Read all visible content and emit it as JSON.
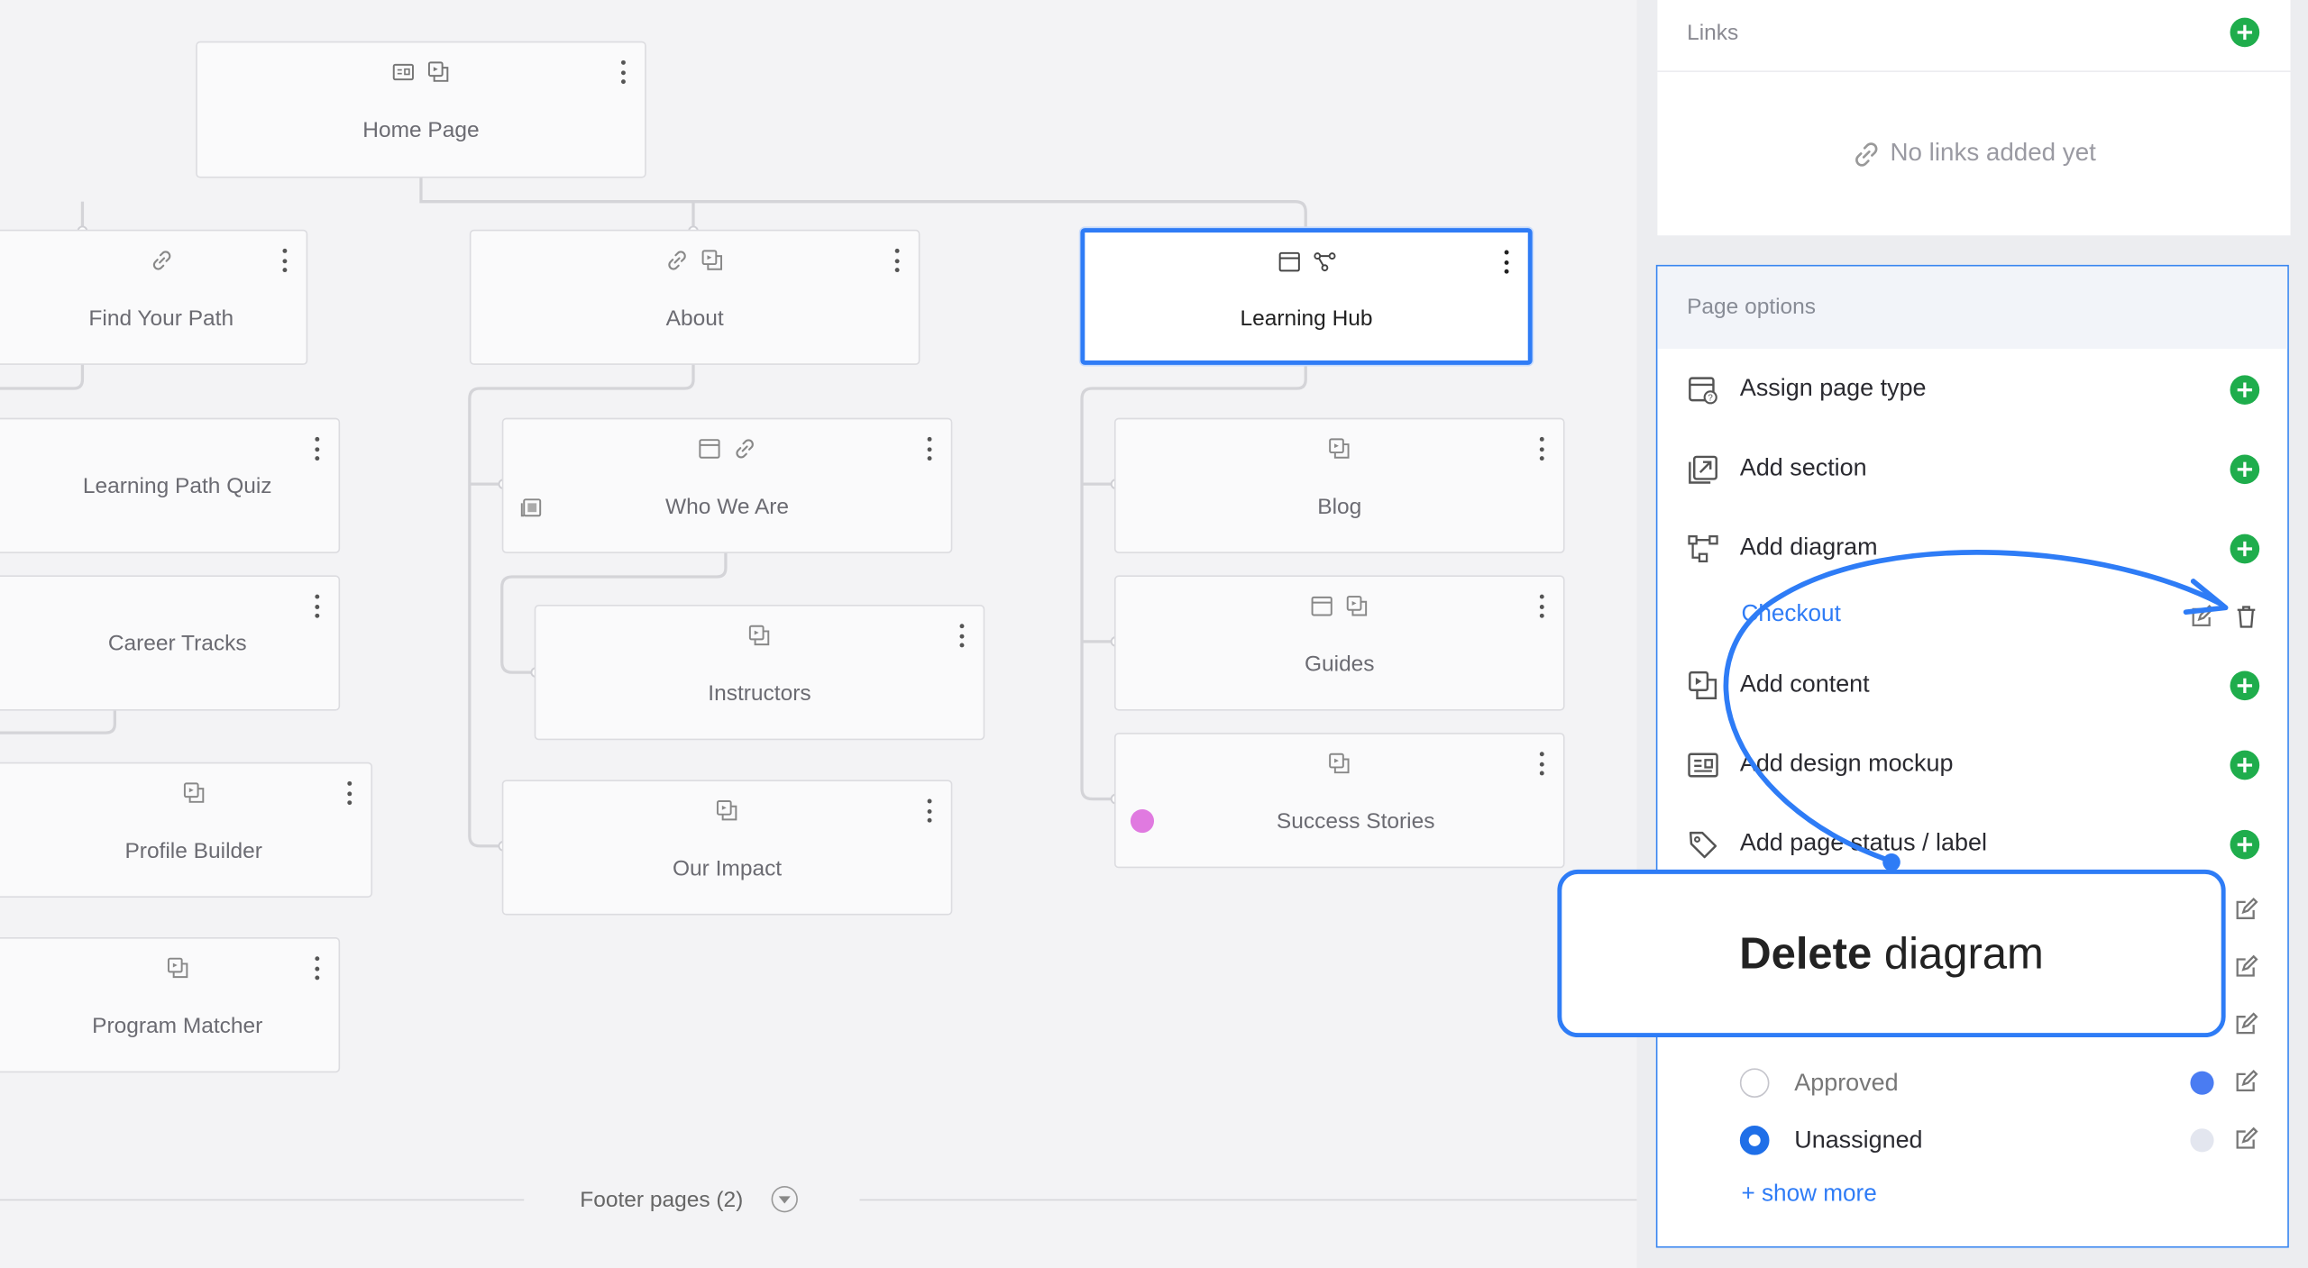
{
  "sitemap": {
    "cards": {
      "home": "Home Page",
      "find_your_path": "Find Your Path",
      "learning_path_quiz": "Learning Path Quiz",
      "career_tracks": "Career Tracks",
      "profile_builder": "Profile Builder",
      "program_matcher": "Program Matcher",
      "about": "About",
      "who_we_are": "Who We Are",
      "instructors": "Instructors",
      "our_impact": "Our Impact",
      "learning_hub": "Learning Hub",
      "blog": "Blog",
      "guides": "Guides",
      "success_stories": "Success Stories"
    },
    "footer_label": "Footer pages (2)"
  },
  "panel": {
    "links": {
      "title": "Links",
      "empty": "No links added yet"
    },
    "page_options": {
      "title": "Page options",
      "items": [
        {
          "label": "Assign page type",
          "icon": "page-type-icon"
        },
        {
          "label": "Add section",
          "icon": "section-icon"
        },
        {
          "label": "Add diagram",
          "icon": "diagram-icon"
        },
        {
          "label": "Add content",
          "icon": "content-icon"
        },
        {
          "label": "Add design mockup",
          "icon": "mockup-icon"
        },
        {
          "label": "Add page status / label",
          "icon": "tag-icon"
        }
      ],
      "diagram_item": "Checkout",
      "statuses": [
        {
          "label": "Approved",
          "color": "#4a7cf2",
          "selected": false
        },
        {
          "label": "Unassigned",
          "color": "#e3e6ef",
          "selected": true
        }
      ],
      "show_more": "+ show more"
    }
  },
  "callout": {
    "bold": "Delete",
    "rest": " diagram"
  },
  "colors": {
    "accent": "#2f7cf6",
    "add_green": "#1fad4c",
    "status_dot_pink": "#e07ae0"
  }
}
